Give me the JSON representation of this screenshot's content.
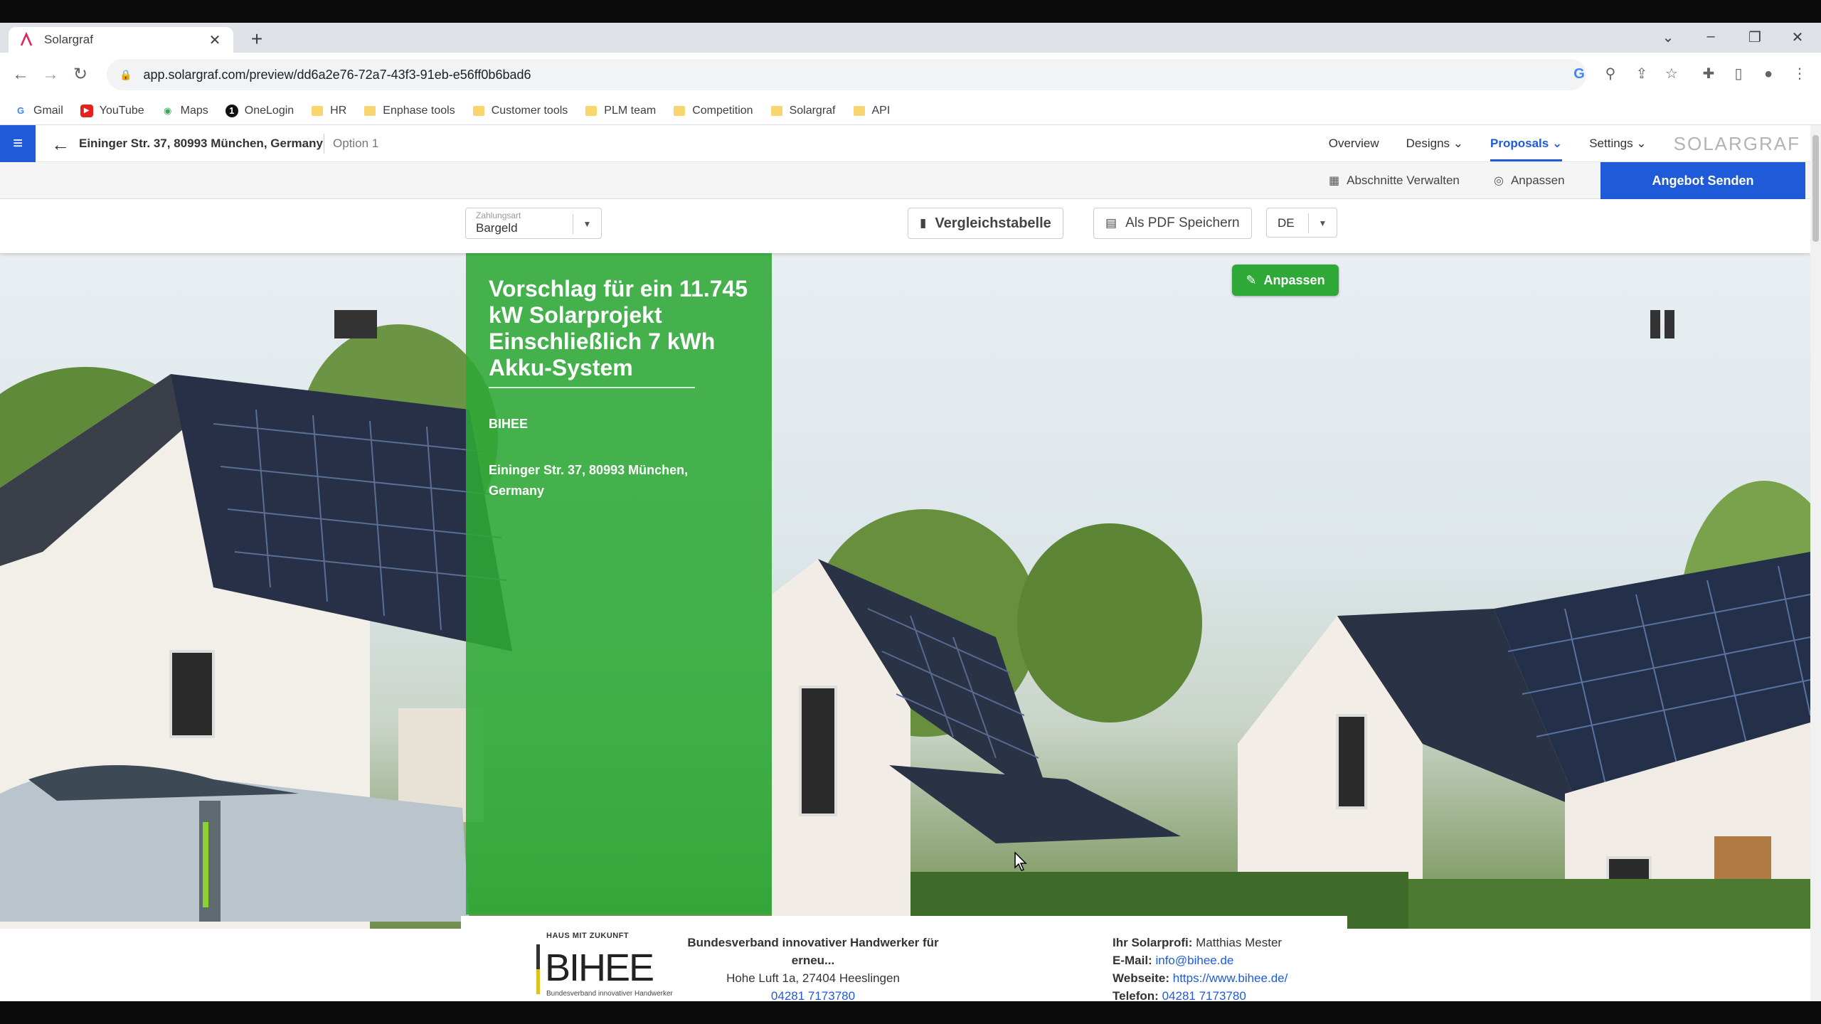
{
  "browser": {
    "tab_title": "Solargraf",
    "url": "app.solargraf.com/preview/dd6a2e76-72a7-43f3-91eb-e56ff0b6bad6",
    "bookmarks": [
      "Gmail",
      "YouTube",
      "Maps",
      "OneLogin",
      "HR",
      "Enphase tools",
      "Customer tools",
      "PLM team",
      "Competition",
      "Solargraf",
      "API"
    ]
  },
  "header": {
    "address": "Eininger Str. 37, 80993 München, Germany",
    "option": "Option 1",
    "nav": [
      "Overview",
      "Designs",
      "Proposals",
      "Settings"
    ],
    "active_nav": "Proposals",
    "logo": "SOLARGRAF"
  },
  "subbar": {
    "manage_sections": "Abschnitte Verwalten",
    "customize": "Anpassen",
    "send_offer": "Angebot Senden"
  },
  "controls": {
    "payment_label": "Zahlungsart",
    "payment_value": "Bargeld",
    "comparison_table": "Vergleichstabelle",
    "save_pdf": "Als PDF Speichern",
    "language": "DE"
  },
  "hero": {
    "title": "Vorschlag für ein 11.745 kW Solarprojekt Einschließlich 7 kWh Akku-System",
    "company": "BIHEE",
    "address": "Eininger Str. 37, 80993 München, Germany",
    "edit_button": "Anpassen"
  },
  "footer": {
    "logo_tag": "HAUS MIT ZUKUNFT",
    "logo_word": "BIHEE",
    "logo_sub": "Bundesverband innovativer Handwerker",
    "org_name": "Bundesverband innovativer Handwerker für erneu...",
    "org_address": "Hohe Luft 1a, 27404 Heeslingen",
    "org_phone": "04281 7173780",
    "pro_label": "Ihr Solarprofi:",
    "pro_name": "Matthias Mester",
    "email_label": "E-Mail:",
    "email": "info@bihee.de",
    "website_label": "Webseite:",
    "website": "https://www.bihee.de/",
    "phone_label": "Telefon:",
    "phone": "04281 7173780"
  },
  "colors": {
    "brand_blue": "#1f5bd8",
    "brand_green": "#2ea836"
  }
}
